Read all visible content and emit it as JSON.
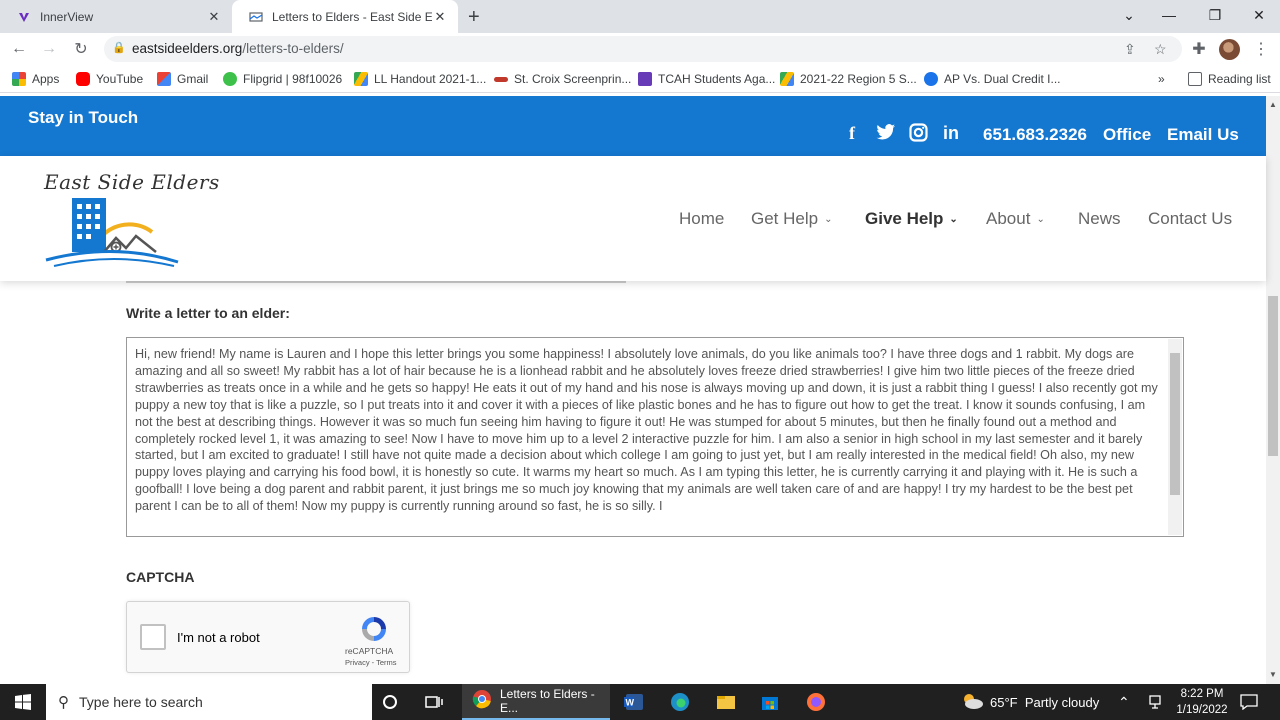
{
  "browser": {
    "tabs": [
      {
        "title": "InnerView",
        "icon": "innerview-icon"
      },
      {
        "title": "Letters to Elders - East Side Elders",
        "icon": "page-icon"
      }
    ],
    "url_domain": "eastsideelders.org",
    "url_path": "/letters-to-elders/",
    "bookmarks": [
      {
        "label": "Apps",
        "color": "#ea4335"
      },
      {
        "label": "YouTube",
        "color": "#ff0000"
      },
      {
        "label": "Gmail",
        "color": "#ea4335"
      },
      {
        "label": "Flipgrid | 98f10026",
        "color": "#3ec14b"
      },
      {
        "label": "LL Handout 2021-1...",
        "color": "#fbbc04"
      },
      {
        "label": "St. Croix Screenprin...",
        "color": "#c0392b"
      },
      {
        "label": "TCAH Students Aga...",
        "color": "#673ab7"
      },
      {
        "label": "2021-22 Region 5 S...",
        "color": "#fbbc04"
      },
      {
        "label": "AP Vs. Dual Credit I...",
        "color": "#1a73e8"
      }
    ],
    "overflow": "»",
    "reading_list": "Reading list"
  },
  "site": {
    "topbar": {
      "stay": "Stay in Touch",
      "phone": "651.683.2326",
      "office": "Office",
      "email": "Email Us"
    },
    "logo_text": "East Side Elders",
    "menu": [
      {
        "label": "Home",
        "chev": ""
      },
      {
        "label": "Get Help",
        "chev": "⌄"
      },
      {
        "label": "Give Help",
        "chev": "⌄"
      },
      {
        "label": "About",
        "chev": "⌄"
      },
      {
        "label": "News",
        "chev": ""
      },
      {
        "label": "Contact Us",
        "chev": ""
      }
    ],
    "form": {
      "letter_label": "Write a letter to an elder:",
      "letter_text": "Hi, new friend! My name is Lauren and I hope this letter brings you some happiness! I absolutely love animals, do you like animals too? I have three dogs and 1 rabbit. My dogs are amazing and all so sweet! My rabbit has a lot of hair because he is a lionhead rabbit and he absolutely loves freeze dried strawberries! I give him two little pieces of the freeze dried strawberries as treats once in a while and he gets so happy! He eats it out of my hand and his nose is always moving up and down, it is just a rabbit thing I guess! I also recently got my puppy a new toy that is like a puzzle, so I put treats into it and cover it with a pieces of like plastic bones and he has to figure out how to get the treat. I know it sounds confusing, I am not the best at describing things. However it was so much fun seeing him having to figure it out! He was stumped for about 5 minutes, but then he finally found out a method and completely rocked level 1, it was amazing to see! Now I have to move him up to a level 2 interactive puzzle for him. I am also a senior in high school in my last semester and it barely started, but I am excited to graduate! I still have not quite made a decision about which college I am going to just yet, but I am really interested in the medical field! Oh also, my new puppy loves playing and carrying his food bowl, it is honestly so cute. It warms my heart so much. As I am typing this letter, he is currently carrying it and playing with it. He is such a goofball! I love being a dog parent and rabbit parent, it just brings me so much joy knowing that my animals are well taken care of and are happy! I try my hardest to be the best pet parent I can be to all of them! Now my puppy is currently running around so fast, he is so silly. I",
      "captcha_label": "CAPTCHA",
      "captcha_check": "I'm not a robot",
      "captcha_brand": "reCAPTCHA",
      "captcha_terms": "Privacy - Terms"
    }
  },
  "taskbar": {
    "search_placeholder": "Type here to search",
    "chrome_label": "Letters to Elders - E...",
    "weather": "65°F  Partly cloudy",
    "time": "8:22 PM",
    "date": "1/19/2022"
  }
}
